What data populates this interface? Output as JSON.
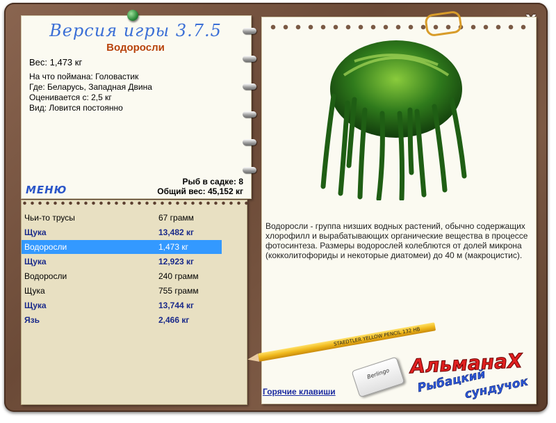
{
  "window": {
    "close_label": "X"
  },
  "header": {
    "version": "Версия игры 3.7.5"
  },
  "fish": {
    "title": "Водоросли",
    "weight": "Вес: 1,473 кг",
    "caught_by": "На что поймана: Головастик",
    "where": "Где: Беларусь, Западная Двина",
    "valued": "Оценивается с: 2,5 кг",
    "kind": "Вид: Ловится постоянно"
  },
  "stats": {
    "fish_count": "Рыб в садке: 8",
    "total_weight": "Общий вес: 45,152 кг"
  },
  "menu_label": "МЕНЮ",
  "catch_list": [
    {
      "name": "Чьи-то трусы",
      "weight": "67 грамм",
      "bold": false,
      "selected": false
    },
    {
      "name": "Щука",
      "weight": "13,482 кг",
      "bold": true,
      "selected": false
    },
    {
      "name": "Водоросли",
      "weight": "1,473 кг",
      "bold": false,
      "selected": true
    },
    {
      "name": "Щука",
      "weight": "12,923 кг",
      "bold": true,
      "selected": false
    },
    {
      "name": "Водоросли",
      "weight": "240 грамм",
      "bold": false,
      "selected": false
    },
    {
      "name": "Щука",
      "weight": "755 грамм",
      "bold": false,
      "selected": false
    },
    {
      "name": "Щука",
      "weight": "13,744 кг",
      "bold": true,
      "selected": false
    },
    {
      "name": "Язь",
      "weight": "2,466 кг",
      "bold": true,
      "selected": false
    }
  ],
  "description": "Водоросли - группа низших водных растений, обычно содержащих хлорофилл и вырабатывающих органические вещества в процессе фотосинтеза. Размеры водорослей колеблются от долей микрона (кокколитофориды и некоторые диатомеи) до 40 м (макроцистис).",
  "hotkeys_label": "Горячие клавиши",
  "decor": {
    "pencil_text": "STAEDTLER  YELLOW PENCIL 132 HB",
    "eraser_text": "Berlingo",
    "logo_line1": "АльманаХ",
    "logo_line2": "Рыбацкий",
    "logo_line3": "сундучок"
  },
  "colors": {
    "frame": "#7d5a45",
    "version": "#3b6fd6",
    "title": "#b8430c",
    "selection": "#3399ff",
    "bold_row": "#1a2a8a",
    "link": "#1a2aa0"
  }
}
